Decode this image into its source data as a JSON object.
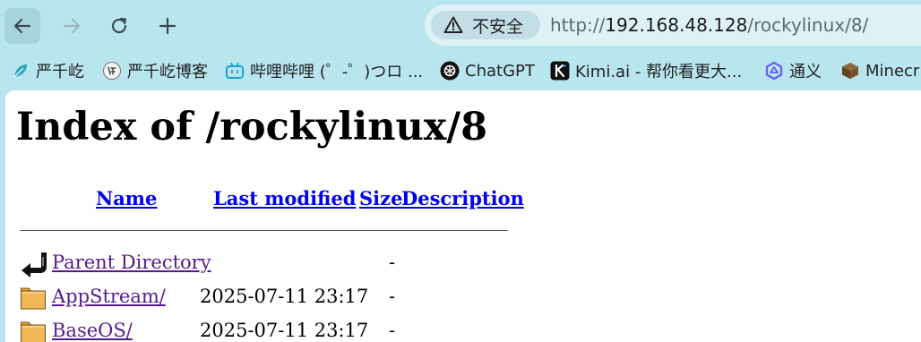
{
  "toolbar": {
    "security_label": "不安全",
    "url": {
      "scheme": "http://",
      "host": "192.168.48.128",
      "path": "/rockylinux/8/"
    }
  },
  "bookmarks": [
    {
      "label": "严千屹",
      "icon": "leaf-icon"
    },
    {
      "label": "严千屹博客",
      "icon": "blog-avatar-icon"
    },
    {
      "label": "哔哩哔哩 (゜-゜)つロ ...",
      "icon": "bilibili-icon"
    },
    {
      "label": "ChatGPT",
      "icon": "chatgpt-icon"
    },
    {
      "label": "Kimi.ai - 帮你看更大...",
      "icon": "kimi-icon"
    },
    {
      "label": "通义",
      "icon": "tongyi-icon"
    },
    {
      "label": "Minecr",
      "icon": "minecraft-icon"
    }
  ],
  "page": {
    "title": "Index of /rockylinux/8",
    "columns": {
      "name": "Name",
      "last_modified": "Last modified",
      "size": "Size",
      "description": "Description"
    },
    "rows": [
      {
        "name": "Parent Directory",
        "date": "",
        "size": "-",
        "icon": "parent-directory-icon"
      },
      {
        "name": "AppStream/",
        "date": "2025-07-11 23:17",
        "size": "-",
        "icon": "folder-icon"
      },
      {
        "name": "BaseOS/",
        "date": "2025-07-11 23:17",
        "size": "-",
        "icon": "folder-icon"
      }
    ]
  },
  "colors": {
    "chrome_bg": "#b9e6ee",
    "link": "#0000ee",
    "visited_link": "#551a8b"
  }
}
